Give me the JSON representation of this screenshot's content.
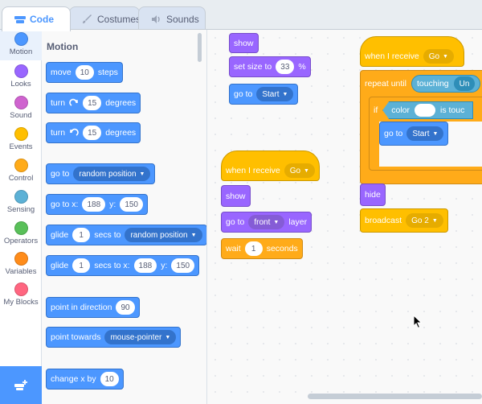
{
  "tabs": [
    {
      "label": "Code",
      "icon": "code-icon"
    },
    {
      "label": "Costumes",
      "icon": "brush-icon"
    },
    {
      "label": "Sounds",
      "icon": "speaker-icon"
    }
  ],
  "categories": [
    {
      "label": "Motion",
      "color": "#4c97ff"
    },
    {
      "label": "Looks",
      "color": "#9966ff"
    },
    {
      "label": "Sound",
      "color": "#cf63cf"
    },
    {
      "label": "Events",
      "color": "#ffbf00"
    },
    {
      "label": "Control",
      "color": "#ffab19"
    },
    {
      "label": "Sensing",
      "color": "#5cb1d6"
    },
    {
      "label": "Operators",
      "color": "#59c059"
    },
    {
      "label": "Variables",
      "color": "#ff8c1a"
    },
    {
      "label": "My Blocks",
      "color": "#ff6680"
    }
  ],
  "palette": {
    "title": "Motion",
    "move": {
      "pre": "move",
      "val": "10",
      "post": "steps"
    },
    "turn_right": {
      "pre": "turn",
      "val": "15",
      "post": "degrees"
    },
    "turn_left": {
      "pre": "turn",
      "val": "15",
      "post": "degrees"
    },
    "goto": {
      "pre": "go to",
      "menu": "random position"
    },
    "gotoxy": {
      "pre": "go to x:",
      "x": "188",
      "ylab": "y:",
      "y": "150"
    },
    "glide_rand": {
      "pre": "glide",
      "val": "1",
      "mid": "secs to",
      "menu": "random position"
    },
    "glide_xy": {
      "pre": "glide",
      "val": "1",
      "mid": "secs to x:",
      "x": "188",
      "ylab": "y:",
      "y": "150"
    },
    "point_dir": {
      "pre": "point in direction",
      "val": "90"
    },
    "point_towards": {
      "pre": "point towards",
      "menu": "mouse-pointer"
    },
    "change_x": {
      "pre": "change x by",
      "val": "10"
    }
  },
  "canvas": {
    "show1": "show",
    "set_size": {
      "pre": "set size to",
      "val": "33",
      "post": "%"
    },
    "goto_start1": {
      "pre": "go to",
      "menu": "Start"
    },
    "hat1": {
      "pre": "when I receive",
      "menu": "Go"
    },
    "show2": "show",
    "goto_layer": {
      "pre": "go to",
      "menu": "front",
      "post": "layer"
    },
    "wait": {
      "pre": "wait",
      "val": "1",
      "post": "seconds"
    },
    "hat2": {
      "pre": "when I receive",
      "menu": "Go"
    },
    "repeat": {
      "pre": "repeat until",
      "sensing": "touching",
      "menu": "Un"
    },
    "if": {
      "pre": "if",
      "color_label": "color",
      "post": "is touc"
    },
    "goto_start2": {
      "pre": "go to",
      "menu": "Start"
    },
    "hide": "hide",
    "broadcast": {
      "pre": "broadcast",
      "menu": "Go 2"
    }
  }
}
